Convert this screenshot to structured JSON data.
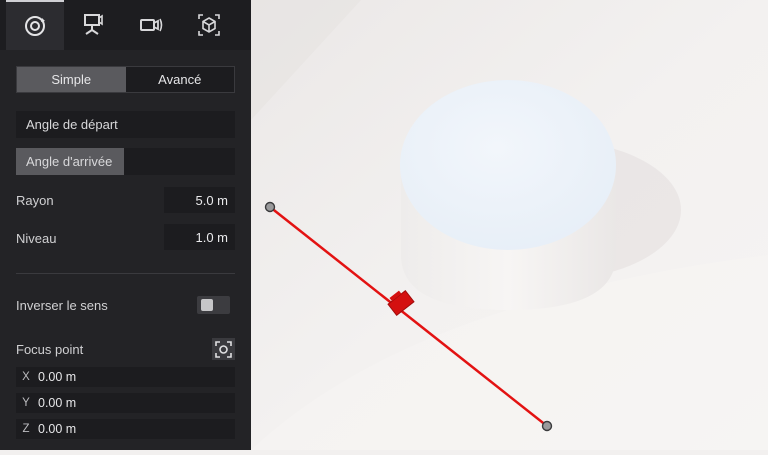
{
  "tabs": [
    {
      "icon": "orbit-camera-icon",
      "active": true
    },
    {
      "icon": "camera-on-tripod-icon",
      "active": false
    },
    {
      "icon": "video-camera-icon",
      "active": false
    },
    {
      "icon": "3d-box-icon",
      "active": false
    }
  ],
  "mode": {
    "simple": "Simple",
    "advanced": "Avancé",
    "selected": "Simple"
  },
  "angles": {
    "start": "Angle de départ",
    "end": "Angle d'arrivée",
    "selected": "end"
  },
  "radius": {
    "label": "Rayon",
    "value": "5.0 m"
  },
  "level": {
    "label": "Niveau",
    "value": "1.0 m"
  },
  "reverse": {
    "label": "Inverser le sens",
    "enabled": false
  },
  "focus": {
    "label": "Focus point",
    "x": {
      "axis": "X",
      "value": "0.00 m"
    },
    "y": {
      "axis": "Y",
      "value": "0.00 m"
    },
    "z": {
      "axis": "Z",
      "value": "0.00 m"
    }
  },
  "colors": {
    "path_line": "#e31212",
    "panel_bg": "#232326",
    "viewport_bg": "#f2f0ef"
  }
}
